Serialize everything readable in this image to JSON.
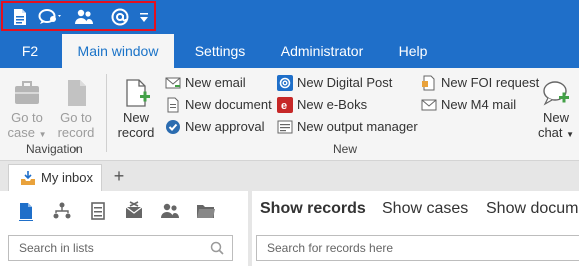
{
  "quick_access": {
    "icons": [
      "document-icon",
      "chat-dropdown-icon",
      "users-icon",
      "at-sign-icon",
      "dropdown-arrow-icon"
    ]
  },
  "ribbon_tabs": [
    "F2",
    "Main window",
    "Settings",
    "Administrator",
    "Help"
  ],
  "ribbon": {
    "navigation": {
      "go_to_case_1": "Go to",
      "go_to_case_2": "case",
      "go_to_record_1": "Go to",
      "go_to_record_2": "record",
      "group_label": "Navigation"
    },
    "new": {
      "new_record_1": "New",
      "new_record_2": "record",
      "new_email": "New email",
      "new_document": "New document",
      "new_approval": "New approval",
      "new_digital_post": "New Digital Post",
      "new_eboks": "New e-Boks",
      "new_output_manager": "New output manager",
      "new_foi_request": "New FOI request",
      "new_m4_mail": "New M4 mail",
      "new_chat_1": "New",
      "new_chat_2": "chat",
      "group_label": "New"
    }
  },
  "doc_tab": {
    "label": "My inbox",
    "add": "+"
  },
  "left_panel": {
    "search_placeholder": "Search in lists"
  },
  "right_panel": {
    "tabs": [
      "Show records",
      "Show cases",
      "Show docume"
    ],
    "search_placeholder": "Search for records here"
  }
}
